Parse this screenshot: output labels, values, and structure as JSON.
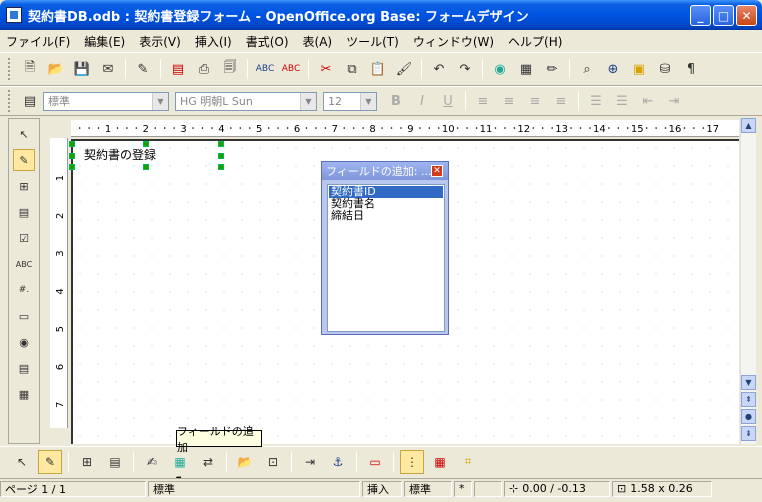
{
  "window": {
    "title": "契約書DB.odb : 契約書登録フォーム - OpenOffice.org Base: フォームデザイン"
  },
  "menu": [
    "ファイル(F)",
    "編集(E)",
    "表示(V)",
    "挿入(I)",
    "書式(O)",
    "表(A)",
    "ツール(T)",
    "ウィンドウ(W)",
    "ヘルプ(H)"
  ],
  "format_toolbar": {
    "style": "標準",
    "font": "HG 明朝L Sun",
    "size": "12"
  },
  "ruler": {
    "top_ticks": [
      "1",
      "2",
      "3",
      "4",
      "5",
      "6",
      "7",
      "8",
      "9",
      "10",
      "11",
      "12",
      "13",
      "14",
      "15",
      "16",
      "17"
    ],
    "left_ticks": [
      "1",
      "2",
      "3",
      "4",
      "5",
      "6",
      "7"
    ]
  },
  "form": {
    "label_text": "契約書の登録"
  },
  "field_dialog": {
    "title": "フィールドの追加: ...",
    "fields": [
      "契約書ID",
      "契約書名",
      "締結日"
    ],
    "selected_index": 0
  },
  "tooltip": "フィールドの追加",
  "statusbar": {
    "page": "ページ 1 / 1",
    "style": "標準",
    "insert_mode": "挿入",
    "selection_mode": "標準",
    "modified": "*",
    "position": "0.00 / -0.13",
    "size": "1.58 x 0.26"
  }
}
